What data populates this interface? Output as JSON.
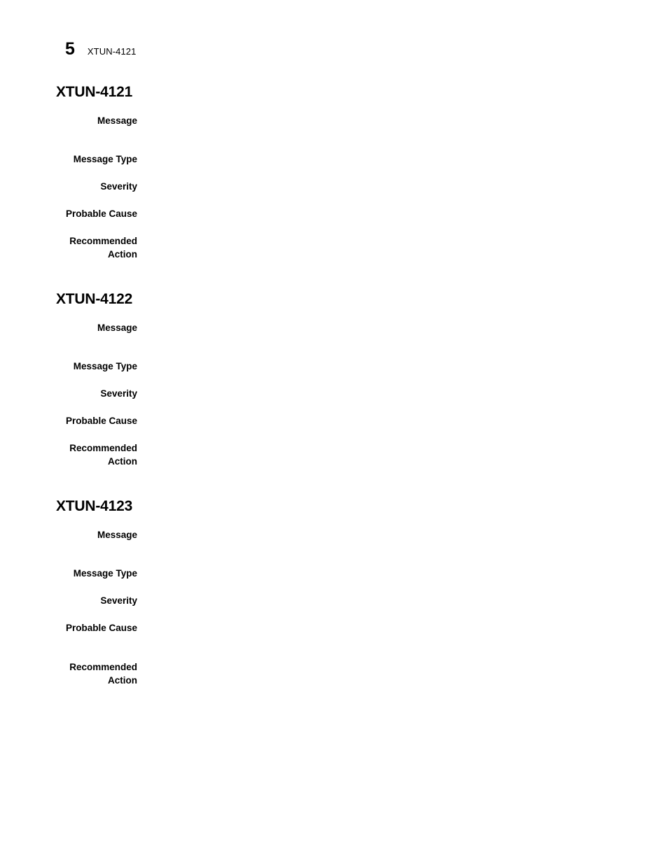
{
  "header": {
    "page_number": "5",
    "chapter_label": "XTUN-4121"
  },
  "field_labels": {
    "message": "Message",
    "message_type": "Message Type",
    "severity": "Severity",
    "probable_cause": "Probable Cause",
    "recommended_action": "Recommended\nAction"
  },
  "sections": [
    {
      "heading": "XTUN-4121",
      "message": "",
      "message_type": "",
      "severity": "",
      "probable_cause": "",
      "recommended_action": ""
    },
    {
      "heading": "XTUN-4122",
      "message": "",
      "message_type": "",
      "severity": "",
      "probable_cause": "",
      "recommended_action": ""
    },
    {
      "heading": "XTUN-4123",
      "message": "",
      "message_type": "",
      "severity": "",
      "probable_cause": "",
      "recommended_action": ""
    }
  ]
}
